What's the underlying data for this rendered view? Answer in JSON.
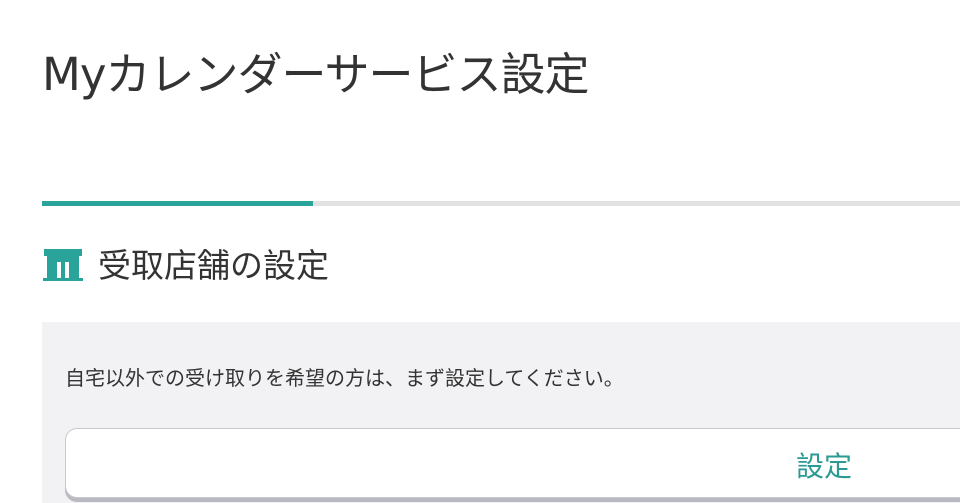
{
  "page": {
    "title": "Myカレンダーサービス設定"
  },
  "progress": {
    "value_fraction": 0.295
  },
  "section": {
    "icon": "store-icon",
    "title": "受取店舗の設定"
  },
  "panel": {
    "description": "自宅以外での受け取りを希望の方は、まず設定してください。",
    "button_label": "設定"
  },
  "colors": {
    "accent": "#2aa49a",
    "text": "#333333",
    "panel_bg": "#f2f2f4",
    "track": "#e2e2e2"
  }
}
